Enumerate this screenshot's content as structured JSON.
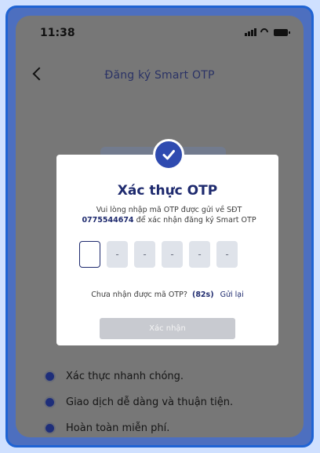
{
  "status_bar": {
    "time": "11:38"
  },
  "header": {
    "title": "Đăng ký Smart OTP"
  },
  "modal": {
    "title": "Xác thực OTP",
    "message_line1": "Vui lòng nhập mã OTP được gửi về SĐT",
    "phone_number": "0775544674",
    "message_suffix": " để xác nhận đăng ký Smart OTP",
    "otp_boxes": [
      "",
      "-",
      "-",
      "-",
      "-",
      "-"
    ],
    "resend_prompt": "Chưa nhận được mã OTP?",
    "countdown": "(82s)",
    "resend_link": "Gửi lại",
    "confirm_label": "Xác nhận"
  },
  "features": [
    {
      "label": "Xác thực nhanh chóng."
    },
    {
      "label": "Giao dịch dễ dàng và thuận tiện."
    },
    {
      "label": "Hoàn toàn miễn phí."
    }
  ],
  "colors": {
    "accent": "#1e2a6e",
    "check_badge": "#2f4bb0",
    "frame_border": "#1e63d4",
    "overlay": "#777777"
  }
}
